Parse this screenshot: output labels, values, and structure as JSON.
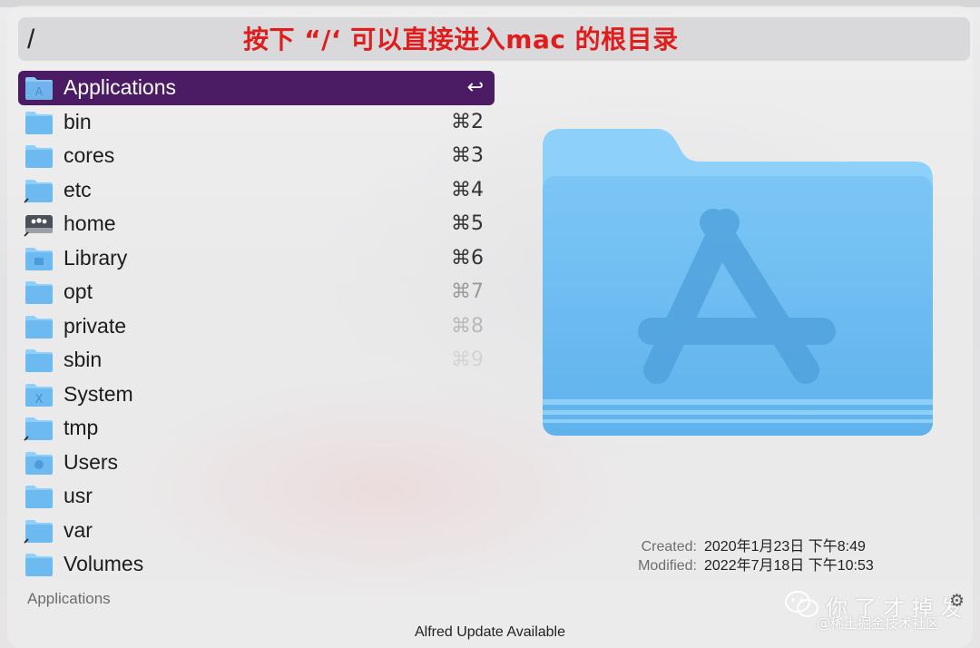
{
  "search": {
    "query": "/"
  },
  "annotation": {
    "text": "按下 “/‘ 可以直接进入mac 的根目录"
  },
  "results": [
    {
      "label": "Applications",
      "shortcut": "↩",
      "icon": "applications-folder-icon",
      "selected": true
    },
    {
      "label": "bin",
      "shortcut": "⌘2",
      "icon": "folder-icon"
    },
    {
      "label": "cores",
      "shortcut": "⌘3",
      "icon": "folder-icon"
    },
    {
      "label": "etc",
      "shortcut": "⌘4",
      "icon": "alias-folder-icon"
    },
    {
      "label": "home",
      "shortcut": "⌘5",
      "icon": "network-drive-icon"
    },
    {
      "label": "Library",
      "shortcut": "⌘6",
      "icon": "library-folder-icon"
    },
    {
      "label": "opt",
      "shortcut": "⌘7",
      "icon": "folder-icon"
    },
    {
      "label": "private",
      "shortcut": "⌘8",
      "icon": "folder-icon"
    },
    {
      "label": "sbin",
      "shortcut": "⌘9",
      "icon": "folder-icon"
    },
    {
      "label": "System",
      "shortcut": "",
      "icon": "system-folder-icon"
    },
    {
      "label": "tmp",
      "shortcut": "",
      "icon": "alias-folder-icon"
    },
    {
      "label": "Users",
      "shortcut": "",
      "icon": "users-folder-icon"
    },
    {
      "label": "usr",
      "shortcut": "",
      "icon": "folder-icon"
    },
    {
      "label": "var",
      "shortcut": "",
      "icon": "alias-folder-icon"
    },
    {
      "label": "Volumes",
      "shortcut": "",
      "icon": "folder-icon"
    }
  ],
  "footer": {
    "path": "Applications",
    "update": "Alfred Update Available"
  },
  "meta": {
    "created_label": "Created:",
    "created_value": "2020年1月23日 下午8:49",
    "modified_label": "Modified:",
    "modified_value": "2022年7月18日 下午10:53"
  },
  "watermark": {
    "title": "你 了 才 掉 发",
    "subtitle": "@稀土掘金技术社区"
  },
  "colors": {
    "selection": "#4b1c63",
    "folder": "#6dbaf0",
    "annotation": "#e01d1d"
  }
}
